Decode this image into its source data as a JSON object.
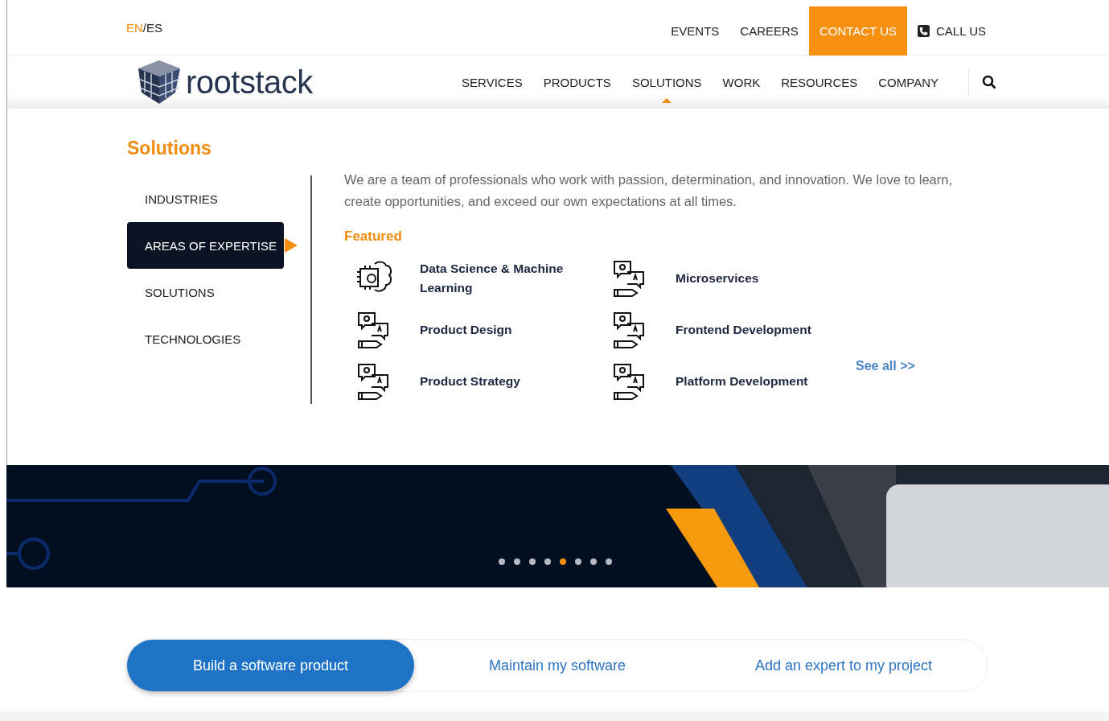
{
  "languages": [
    {
      "label": "EN",
      "selected": true
    },
    {
      "label": "ES",
      "selected": false
    }
  ],
  "language_separator": "/",
  "top_links": [
    {
      "label": "EVENTS",
      "kind": "link"
    },
    {
      "label": "CAREERS",
      "kind": "link"
    },
    {
      "label": "CONTACT US",
      "kind": "highlight"
    },
    {
      "label": "CALL US",
      "kind": "phone"
    }
  ],
  "logo": "rootstack",
  "main_nav": [
    {
      "label": "SERVICES",
      "selected": false
    },
    {
      "label": "PRODUCTS",
      "selected": false
    },
    {
      "label": "SOLUTIONS",
      "selected": true
    },
    {
      "label": "WORK",
      "selected": false
    },
    {
      "label": "RESOURCES",
      "selected": false
    },
    {
      "label": "COMPANY",
      "selected": false
    }
  ],
  "mega_menu": {
    "title": "Solutions",
    "side_items": [
      {
        "label": "INDUSTRIES",
        "selected": false
      },
      {
        "label": "AREAS OF EXPERTISE",
        "selected": true
      },
      {
        "label": "SOLUTIONS",
        "selected": false
      },
      {
        "label": "TECHNOLOGIES",
        "selected": false
      }
    ],
    "description": "We are a team of professionals who work with passion, determination, and innovation. We love to learn, create opportunities, and exceed our own expectations at all times.",
    "featured_label": "Featured",
    "featured": [
      {
        "label": "Data Science & Machine Learning",
        "kind": "brain"
      },
      {
        "label": "Microservices",
        "kind": "qa"
      },
      {
        "label": "Product Design",
        "kind": "qa"
      },
      {
        "label": "Frontend Development",
        "kind": "qa"
      },
      {
        "label": "Product Strategy",
        "kind": "qa"
      },
      {
        "label": "Platform Development",
        "kind": "qa"
      }
    ],
    "see_all": "See all >>"
  },
  "hero": {
    "kind": "picture",
    "dots": [
      {
        "selected": false
      },
      {
        "selected": false
      },
      {
        "selected": false
      },
      {
        "selected": false
      },
      {
        "selected": true
      },
      {
        "selected": false
      },
      {
        "selected": false
      },
      {
        "selected": false
      }
    ]
  },
  "goal_tabs": [
    {
      "label": "Build a software product",
      "selected": true
    },
    {
      "label": "Maintain my software",
      "selected": false
    },
    {
      "label": "Add an expert to my project",
      "selected": false
    }
  ]
}
